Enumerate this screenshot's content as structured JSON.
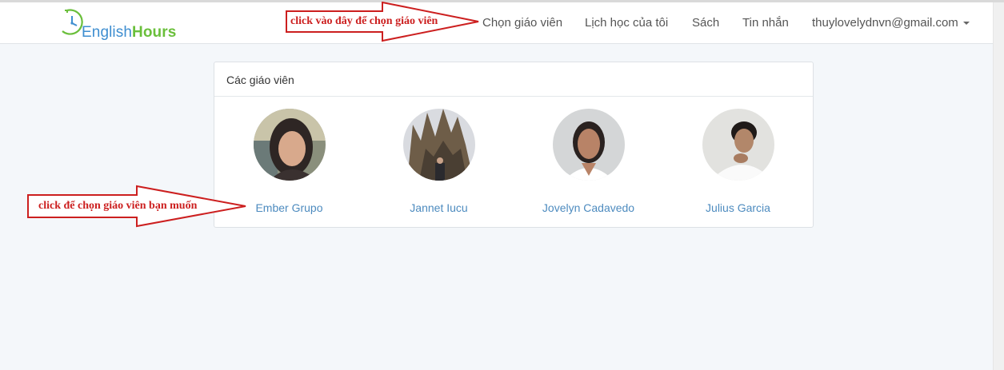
{
  "logo": {
    "text_part1": "English",
    "text_part2": "Hours",
    "icon": "clock-icon"
  },
  "nav": {
    "items": [
      {
        "label": "Chọn giáo viên"
      },
      {
        "label": "Lịch học của tôi"
      },
      {
        "label": "Sách"
      },
      {
        "label": "Tin nhắn"
      }
    ],
    "account": "thuylovelydnvn@gmail.com",
    "account_icon": "caret-down-icon"
  },
  "panel": {
    "title": "Các giáo viên",
    "teachers": [
      {
        "name": "Ember Grupo"
      },
      {
        "name": "Jannet Iucu"
      },
      {
        "name": "Jovelyn Cadavedo"
      },
      {
        "name": "Julius Garcia"
      }
    ]
  },
  "annotations": {
    "top_callout": "click vào đây để chọn giáo viên",
    "left_callout": "click để chọn giáo viên bạn muốn"
  },
  "colors": {
    "background": "#f4f7fa",
    "link": "#4d8bbf",
    "annotation": "#cc1f1f",
    "logo_blue": "#3e8ed0",
    "logo_green": "#6abf3b"
  }
}
